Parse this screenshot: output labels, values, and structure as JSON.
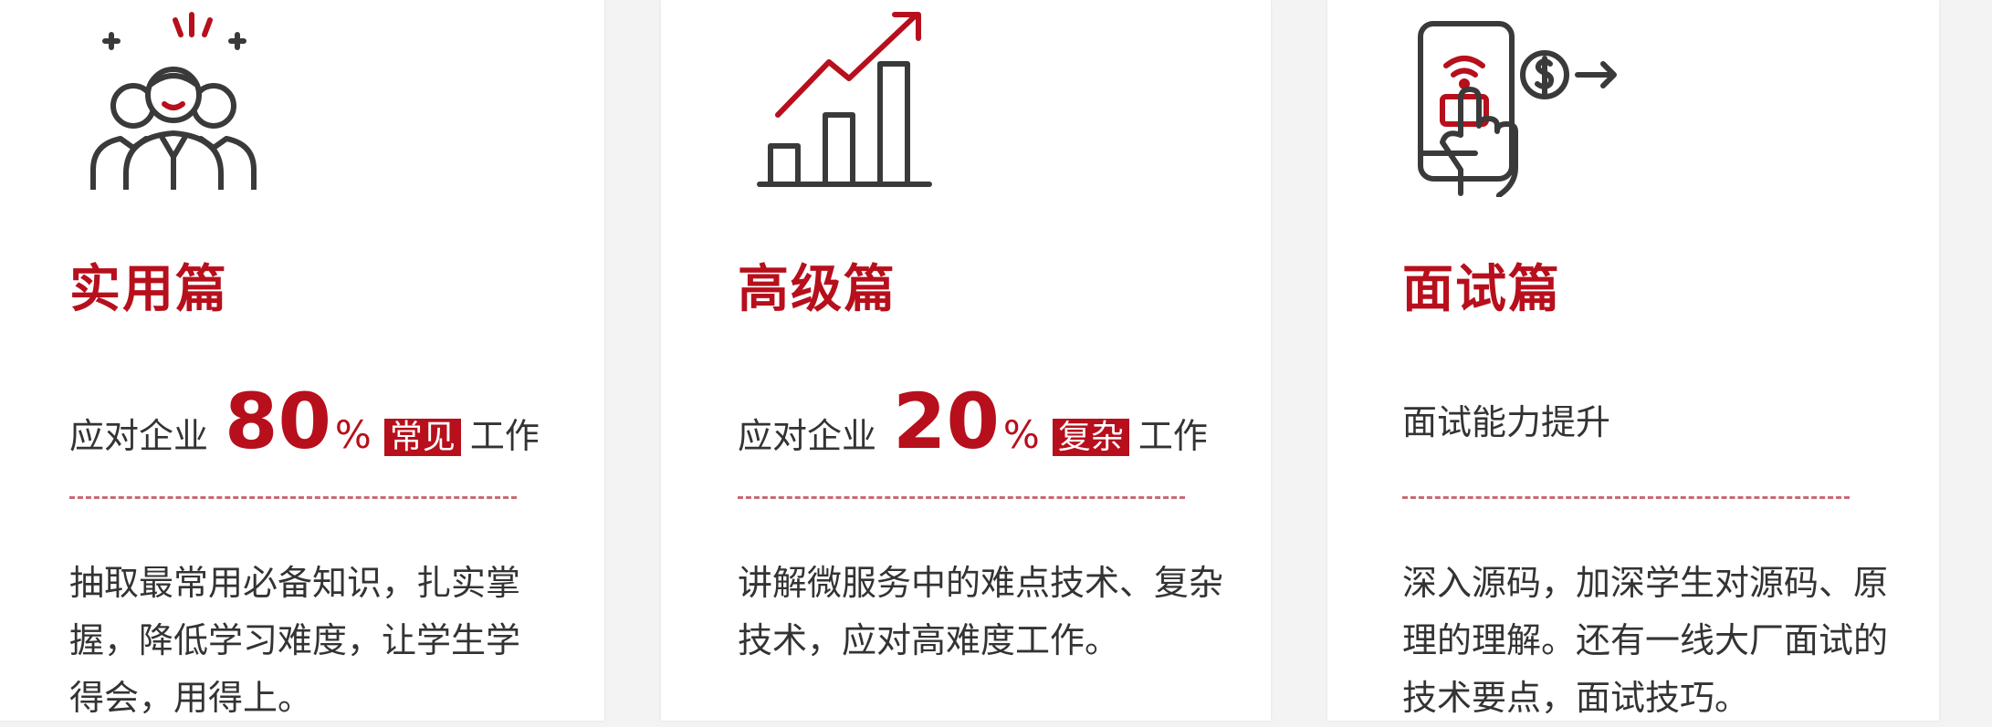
{
  "colors": {
    "accent": "#b70f1c",
    "text": "#333333",
    "icon_stroke": "#3a3a3a"
  },
  "cards": [
    {
      "icon": "team-people-icon",
      "title": "实用篇",
      "subtitle_prefix": "应对企业",
      "big_number": "80",
      "percent": "%",
      "tag": "常见",
      "subtitle_suffix": "工作",
      "description": "抽取最常用必备知识，扎实掌握，降低学习难度，让学生学得会，用得上。"
    },
    {
      "icon": "bar-chart-growth-icon",
      "title": "高级篇",
      "subtitle_prefix": "应对企业",
      "big_number": "20",
      "percent": "%",
      "tag": "复杂",
      "subtitle_suffix": "工作",
      "description": "讲解微服务中的难点技术、复杂技术，应对高难度工作。"
    },
    {
      "icon": "phone-payment-icon",
      "title": "面试篇",
      "subtitle_text": "面试能力提升",
      "description": "深入源码，加深学生对源码、原理的理解。还有一线大厂面试的技术要点，面试技巧。"
    }
  ]
}
